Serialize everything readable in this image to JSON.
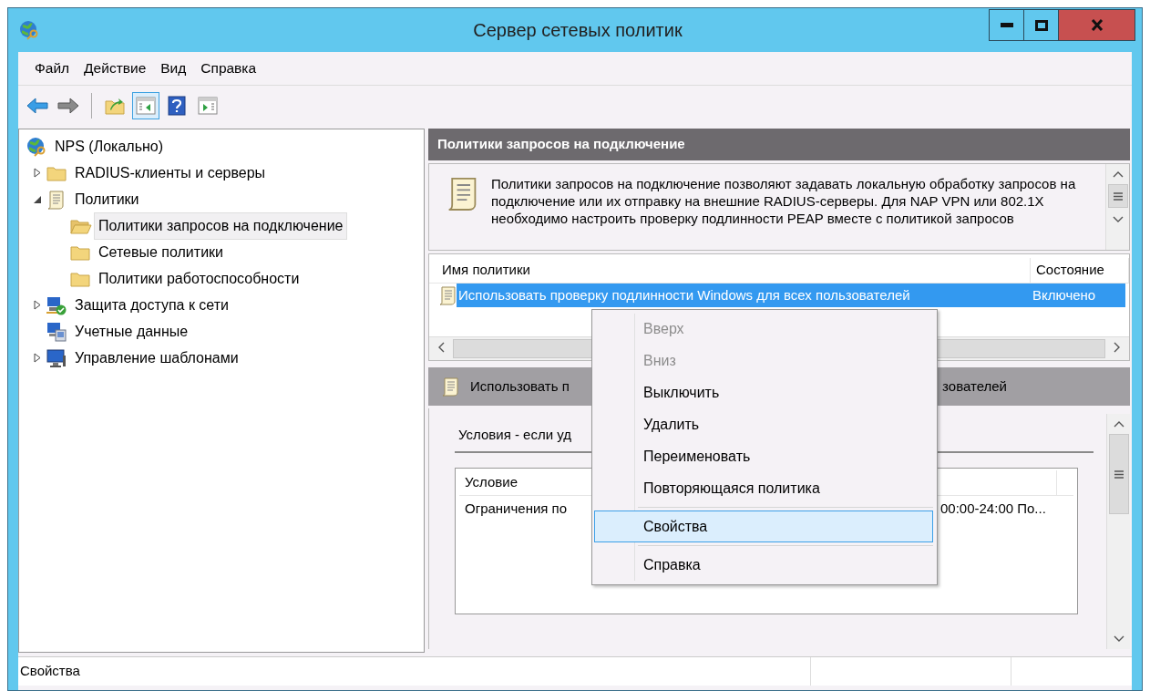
{
  "window": {
    "title": "Сервер сетевых политик"
  },
  "menu_bar": [
    "Файл",
    "Действие",
    "Вид",
    "Справка"
  ],
  "toolbar": [
    {
      "kind": "back",
      "disabled": false,
      "pressed": false
    },
    {
      "kind": "forward",
      "disabled": true,
      "pressed": false
    },
    {
      "kind": "separator"
    },
    {
      "kind": "up",
      "disabled": false,
      "pressed": false
    },
    {
      "kind": "tree_toggle",
      "disabled": false,
      "pressed": true
    },
    {
      "kind": "help",
      "disabled": false,
      "pressed": false
    },
    {
      "kind": "action_toggle",
      "disabled": false,
      "pressed": false
    }
  ],
  "tree": [
    {
      "label": "NPS (Локально)",
      "kind": "server",
      "selected": false,
      "children": [
        {
          "label": "RADIUS-клиенты и серверы",
          "kind": "folder",
          "selected": false,
          "expanded": false
        },
        {
          "label": "Политики",
          "kind": "scroll",
          "selected": false,
          "expanded": true,
          "children": [
            {
              "label": "Политики запросов на подключение",
              "kind": "folder_open",
              "selected": true
            },
            {
              "label": "Сетевые политики",
              "kind": "folder",
              "selected": false
            },
            {
              "label": "Политики работоспособности",
              "kind": "folder",
              "selected": false
            }
          ]
        },
        {
          "label": "Защита доступа к сети",
          "kind": "nap",
          "selected": false,
          "expanded": false
        },
        {
          "label": "Учетные данные",
          "kind": "accounting",
          "selected": false
        },
        {
          "label": "Управление шаблонами",
          "kind": "monitor",
          "selected": false,
          "expanded": false
        }
      ]
    }
  ],
  "pane": {
    "header": "Политики запросов на подключение",
    "description": "Политики запросов на подключение позволяют задавать локальную обработку запросов на подключение или их отправку на внешние RADIUS-серверы. Для NAP VPN или 802.1X необходимо настроить проверку подлинности PEAP вместе с политикой запросов",
    "list": {
      "columns": [
        "Имя политики",
        "Состояние"
      ],
      "rows": [
        {
          "cells": [
            "Использовать проверку подлинности Windows для всех пользователей",
            "Включено"
          ],
          "selected": true
        }
      ]
    },
    "details": {
      "header_parts": [
        "Использовать п",
        "зователей"
      ],
      "section_title": "Условия - если уд",
      "table": {
        "columns": [
          "Условие"
        ],
        "rows": [
          {
            "cells": [
              "Ограничения по",
              "00:00-24:00 По..."
            ]
          }
        ]
      }
    }
  },
  "context_menu": [
    {
      "kind": "item",
      "label": "Вверх",
      "disabled": true,
      "selected": false
    },
    {
      "kind": "item",
      "label": "Вниз",
      "disabled": true,
      "selected": false
    },
    {
      "kind": "item",
      "label": "Выключить",
      "disabled": false,
      "selected": false
    },
    {
      "kind": "item",
      "label": "Удалить",
      "disabled": false,
      "selected": false
    },
    {
      "kind": "item",
      "label": "Переименовать",
      "disabled": false,
      "selected": false
    },
    {
      "kind": "item",
      "label": "Повторяющаяся политика",
      "disabled": false,
      "selected": false
    },
    {
      "kind": "separator"
    },
    {
      "kind": "item",
      "label": "Свойства",
      "disabled": false,
      "selected": true
    },
    {
      "kind": "separator"
    },
    {
      "kind": "item",
      "label": "Справка",
      "disabled": false,
      "selected": false
    }
  ],
  "status_bar": {
    "text": "Свойства"
  }
}
